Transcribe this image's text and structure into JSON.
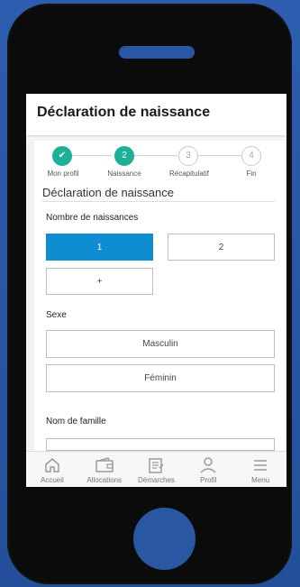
{
  "header": {
    "title": "Déclaration de naissance"
  },
  "stepper": {
    "steps": [
      {
        "number": "✔",
        "label": "Mon profil"
      },
      {
        "number": "2",
        "label": "Naissance"
      },
      {
        "number": "3",
        "label": "Récapitulatif"
      },
      {
        "number": "4",
        "label": "Fin"
      }
    ]
  },
  "form": {
    "section_title": "Déclaration de naissance",
    "births": {
      "label": "Nombre de naissances",
      "options": [
        "1",
        "2",
        "+"
      ],
      "selected": "1"
    },
    "sex": {
      "label": "Sexe",
      "options": [
        "Masculin",
        "Féminin"
      ]
    },
    "family_name": {
      "label": "Nom de famille",
      "value": ""
    }
  },
  "tabbar": {
    "items": [
      {
        "label": "Accueil",
        "icon": "home-icon"
      },
      {
        "label": "Allocations",
        "icon": "wallet-icon"
      },
      {
        "label": "Démarches",
        "icon": "document-icon"
      },
      {
        "label": "Profil",
        "icon": "user-icon"
      },
      {
        "label": "Menu",
        "icon": "menu-icon"
      }
    ]
  },
  "colors": {
    "background": "#2a57a4",
    "accent_green": "#1cb196",
    "selected_blue": "#0e8ed0"
  }
}
